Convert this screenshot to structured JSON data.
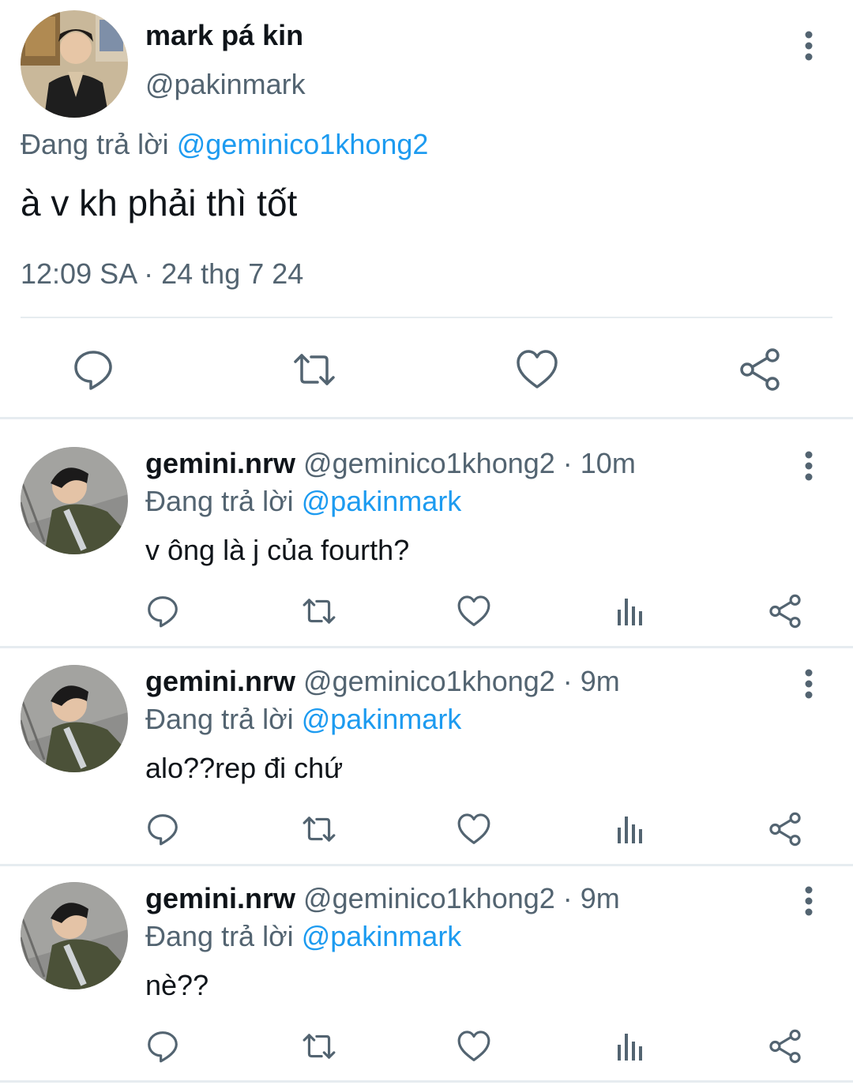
{
  "main_tweet": {
    "display_name": "mark pá kin",
    "handle": "@pakinmark",
    "reply_prefix": "Đang trả lời",
    "reply_mention": "@geminico1khong2",
    "text": "à v kh phải thì tốt",
    "timestamp": "12:09 SA · 24 thg 7 24",
    "icons": [
      "reply-icon",
      "retweet-icon",
      "like-icon",
      "share-icon"
    ]
  },
  "replies": [
    {
      "display_name": "gemini.nrw",
      "meta": " @geminico1khong2 · 10m",
      "reply_prefix": "Đang trả lời",
      "reply_mention": "@pakinmark",
      "text": "v ông là j của fourth?"
    },
    {
      "display_name": "gemini.nrw",
      "meta": " @geminico1khong2 · 9m",
      "reply_prefix": "Đang trả lời",
      "reply_mention": "@pakinmark",
      "text": "alo??rep đi chứ"
    },
    {
      "display_name": "gemini.nrw",
      "meta": " @geminico1khong2 · 9m",
      "reply_prefix": "Đang trả lời",
      "reply_mention": "@pakinmark",
      "text": "nè??"
    }
  ],
  "reply_icons": [
    "reply-icon",
    "retweet-icon",
    "like-icon",
    "views-icon",
    "share-icon"
  ],
  "colors": {
    "text_primary": "#0f1419",
    "text_secondary": "#536471",
    "mention": "#1d9bf0",
    "divider": "#e6ecf0"
  }
}
